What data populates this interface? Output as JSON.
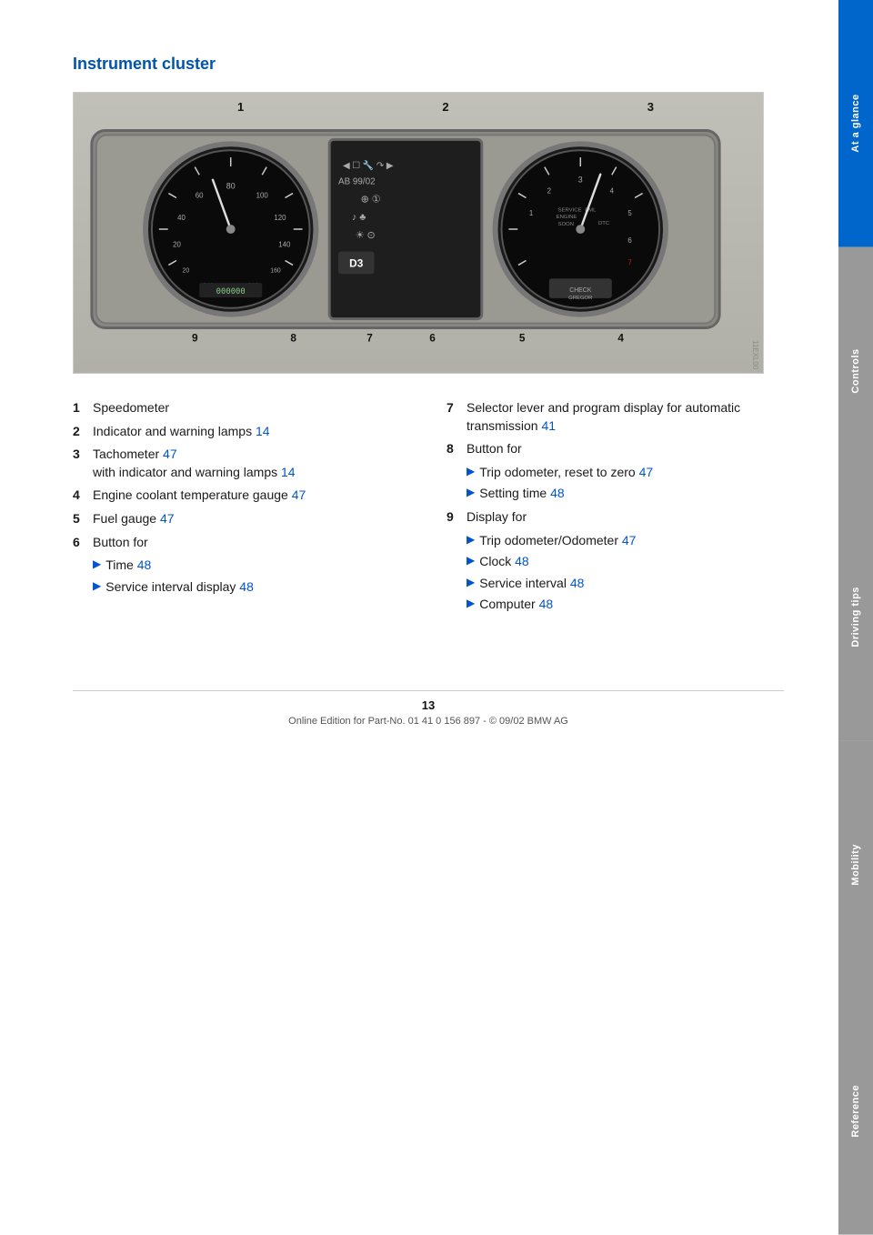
{
  "page": {
    "title": "Instrument cluster",
    "page_number": "13",
    "footer_text": "Online Edition for Part-No. 01 41 0 156 897 - © 09/02 BMW AG"
  },
  "sidebar": {
    "tabs": [
      {
        "id": "at-a-glance",
        "label": "At a glance",
        "active": true
      },
      {
        "id": "controls",
        "label": "Controls",
        "active": false
      },
      {
        "id": "driving-tips",
        "label": "Driving tips",
        "active": false
      },
      {
        "id": "mobility",
        "label": "Mobility",
        "active": false
      },
      {
        "id": "reference",
        "label": "Reference",
        "active": false
      }
    ]
  },
  "items_left": [
    {
      "number": "1",
      "text": "Speedometer",
      "page_ref": null,
      "sub_items": []
    },
    {
      "number": "2",
      "text": "Indicator and warning lamps",
      "page_ref": "14",
      "sub_items": []
    },
    {
      "number": "3",
      "text": "Tachometer",
      "page_ref": "47",
      "sub_note": "with indicator and warning lamps",
      "sub_note_ref": "14",
      "sub_items": []
    },
    {
      "number": "4",
      "text": "Engine coolant temperature gauge",
      "page_ref": "47",
      "sub_items": []
    },
    {
      "number": "5",
      "text": "Fuel gauge",
      "page_ref": "47",
      "sub_items": []
    },
    {
      "number": "6",
      "text": "Button for",
      "page_ref": null,
      "sub_items": [
        {
          "text": "Time",
          "page_ref": "48"
        },
        {
          "text": "Service interval display",
          "page_ref": "48"
        }
      ]
    }
  ],
  "items_right": [
    {
      "number": "7",
      "text": "Selector lever and program display for automatic transmission",
      "page_ref": "41",
      "sub_items": []
    },
    {
      "number": "8",
      "text": "Button for",
      "page_ref": null,
      "sub_items": [
        {
          "text": "Trip odometer, reset to zero",
          "page_ref": "47"
        },
        {
          "text": "Setting time",
          "page_ref": "48"
        }
      ]
    },
    {
      "number": "9",
      "text": "Display for",
      "page_ref": null,
      "sub_items": [
        {
          "text": "Trip odometer/Odometer",
          "page_ref": "47"
        },
        {
          "text": "Clock",
          "page_ref": "48"
        },
        {
          "text": "Service interval",
          "page_ref": "48"
        },
        {
          "text": "Computer",
          "page_ref": "48"
        }
      ]
    }
  ],
  "callout_numbers_top": [
    "1",
    "2",
    "3"
  ],
  "callout_numbers_bottom": [
    "9",
    "8",
    "7",
    "6",
    "5",
    "4"
  ],
  "colors": {
    "accent_blue": "#0055aa",
    "link_blue": "#0055cc",
    "sidebar_active": "#0066cc",
    "sidebar_inactive": "#999999"
  }
}
